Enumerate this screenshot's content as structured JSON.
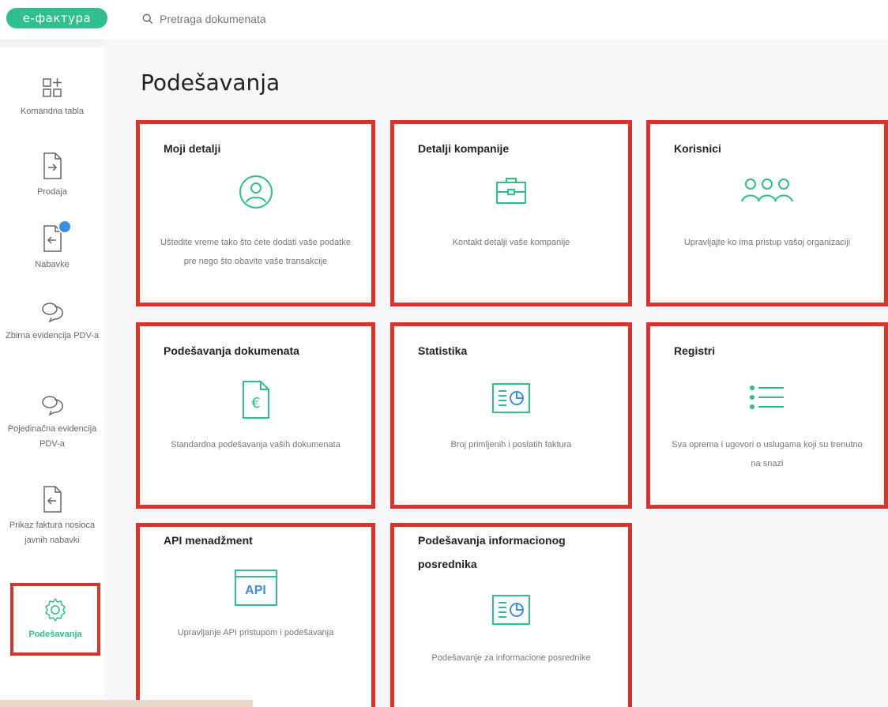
{
  "header": {
    "logo": "e-фактура",
    "search_placeholder": "Pretraga dokumenata"
  },
  "sidebar": {
    "items": [
      {
        "label": "Komandna tabla",
        "icon": "dashboard-icon"
      },
      {
        "label": "Prodaja",
        "icon": "outgoing-document-icon"
      },
      {
        "label": "Nabavke",
        "icon": "incoming-document-icon"
      },
      {
        "label": "Zbirna evidencija PDV-a",
        "icon": "chat-bubbles-icon"
      },
      {
        "label": "Pojedinačna evidencija PDV-a",
        "icon": "chat-bubbles-icon"
      },
      {
        "label": "Prikaz faktura nosioca javnih nabavki",
        "icon": "incoming-document-icon"
      },
      {
        "label": "Podešavanja",
        "icon": "gear-icon",
        "active": true
      }
    ]
  },
  "main": {
    "title": "Podešavanja",
    "cards": [
      {
        "title": "Moji detalji",
        "desc": "Uštedite vreme tako što ćete dodati vaše podatke pre nego što obavite vaše transakcije",
        "icon": "user-circle-icon"
      },
      {
        "title": "Detalji kompanije",
        "desc": "Kontakt detalji vaše kompanije",
        "icon": "briefcase-icon"
      },
      {
        "title": "Korisnici",
        "desc": "Upravljajte ko ima pristup vašoj organizaciji",
        "icon": "users-group-icon"
      },
      {
        "title": "Podešavanja dokumenata",
        "desc": "Standardna podešavanja vaših dokumenata",
        "icon": "euro-document-icon"
      },
      {
        "title": "Statistika",
        "desc": "Broj primljenih i poslatih faktura",
        "icon": "statistics-icon"
      },
      {
        "title": "Registri",
        "desc": "Sva oprema i ugovori o uslugama koji su trenutno na snazi",
        "icon": "list-icon"
      },
      {
        "title": "API menadžment",
        "desc": "Upravljanje API pristupom i podešavanja",
        "icon": "api-icon",
        "icon_text": "API"
      },
      {
        "title": "Podešavanja informacionog posrednika",
        "desc": "Podešavanje za informacione posrednike",
        "icon": "statistics-icon"
      }
    ]
  },
  "colors": {
    "accent": "#2fbe8c",
    "highlight": "#d9342b",
    "badge": "#3b8ee3"
  }
}
